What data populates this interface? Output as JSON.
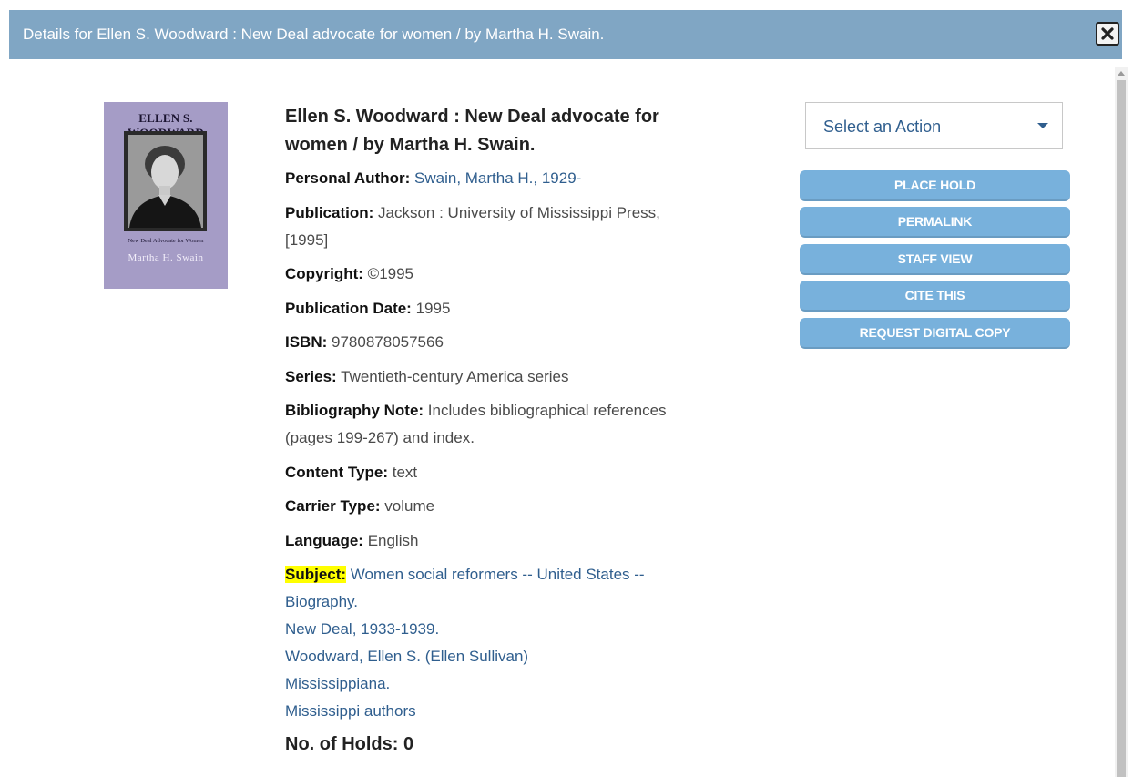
{
  "dialog": {
    "title": "Details for Ellen S. Woodward : New Deal advocate for women / by Martha H. Swain."
  },
  "cover": {
    "title": "ELLEN S. WOODWARD",
    "subtitle": "New Deal Advocate for Women",
    "author": "Martha H. Swain"
  },
  "record": {
    "title": "Ellen S. Woodward : New Deal advocate for women / by Martha H. Swain.",
    "personal_author": {
      "label": "Personal Author:",
      "value": "Swain, Martha H., 1929-"
    },
    "publication": {
      "label": "Publication:",
      "value": "Jackson : University of Mississippi Press, [1995]"
    },
    "copyright": {
      "label": "Copyright:",
      "value": "©1995"
    },
    "publication_date": {
      "label": "Publication Date:",
      "value": "1995"
    },
    "isbn": {
      "label": "ISBN:",
      "value": "9780878057566"
    },
    "series": {
      "label": "Series:",
      "value": "Twentieth-century America series"
    },
    "bibliography_note": {
      "label": "Bibliography Note:",
      "value": "Includes bibliographical references (pages 199-267) and index."
    },
    "content_type": {
      "label": "Content Type:",
      "value": "text"
    },
    "carrier_type": {
      "label": "Carrier Type:",
      "value": "volume"
    },
    "language": {
      "label": "Language:",
      "value": "English"
    },
    "subject": {
      "label": "Subject:",
      "items": [
        "Women social reformers -- United States -- Biography.",
        "New Deal, 1933-1939.",
        "Woodward, Ellen S. (Ellen Sullivan)",
        "Mississippiana.",
        "Mississippi authors"
      ]
    },
    "holds": "No. of Holds: 0"
  },
  "actions": {
    "select_label": "Select an Action",
    "buttons": [
      "PLACE HOLD",
      "PERMALINK",
      "STAFF VIEW",
      "CITE THIS",
      "REQUEST DIGITAL COPY"
    ]
  },
  "colors": {
    "header_bg": "#80a6c4",
    "button_bg": "#78b1dc",
    "link": "#2f5e8e",
    "highlight": "#ffff00"
  }
}
